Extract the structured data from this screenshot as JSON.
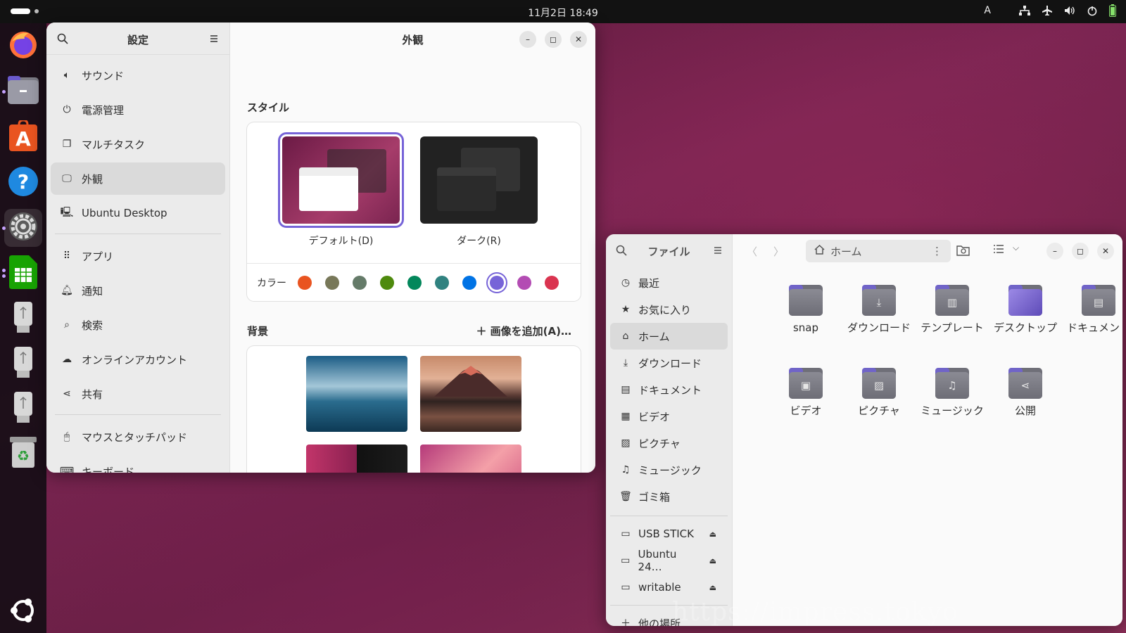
{
  "topbar": {
    "clock": "11月2日  18:49",
    "ime": "A"
  },
  "dock": {
    "apps": [
      "firefox-icon",
      "files-icon",
      "app-center-icon",
      "help-icon",
      "settings-icon",
      "spreadsheet-icon",
      "usb-drive-icon",
      "usb-drive-icon",
      "usb-drive-icon",
      "trash-icon"
    ],
    "bottom": "ubuntu-logo-icon"
  },
  "settings": {
    "sidebar_title": "設定",
    "page_title": "外観",
    "items": [
      {
        "label": "サウンド",
        "icon": "speaker-icon"
      },
      {
        "label": "電源管理",
        "icon": "power-icon"
      },
      {
        "label": "マルチタスク",
        "icon": "multitask-icon"
      },
      {
        "label": "外観",
        "icon": "appearance-icon",
        "selected": true
      },
      {
        "label": "Ubuntu Desktop",
        "icon": "desktop-icon"
      },
      {
        "label": "アプリ",
        "icon": "apps-grid-icon"
      },
      {
        "label": "通知",
        "icon": "bell-icon"
      },
      {
        "label": "検索",
        "icon": "search-icon"
      },
      {
        "label": "オンラインアカウント",
        "icon": "cloud-icon"
      },
      {
        "label": "共有",
        "icon": "share-icon"
      },
      {
        "label": "マウスとタッチパッド",
        "icon": "mouse-icon"
      },
      {
        "label": "キーボード",
        "icon": "keyboard-icon"
      }
    ],
    "style_section": "スタイル",
    "style_default": "デフォルト(D)",
    "style_dark": "ダーク(R)",
    "color_label": "カラー",
    "colors": [
      "#e95420",
      "#787859",
      "#657b69",
      "#4e8a0d",
      "#03875b",
      "#308280",
      "#0073e5",
      "#7764d8",
      "#b34cb3",
      "#da3450"
    ],
    "selected_color": "#7764d8",
    "background_section": "背景",
    "add_image": "画像を追加(A)…"
  },
  "files": {
    "sidebar_title": "ファイル",
    "path": "ホーム",
    "places": [
      {
        "label": "最近",
        "icon": "clock-icon"
      },
      {
        "label": "お気に入り",
        "icon": "star-icon"
      },
      {
        "label": "ホーム",
        "icon": "home-icon",
        "selected": true
      },
      {
        "label": "ダウンロード",
        "icon": "download-icon"
      },
      {
        "label": "ドキュメント",
        "icon": "document-icon"
      },
      {
        "label": "ビデオ",
        "icon": "video-icon"
      },
      {
        "label": "ピクチャ",
        "icon": "picture-icon"
      },
      {
        "label": "ミュージック",
        "icon": "music-icon"
      },
      {
        "label": "ゴミ箱",
        "icon": "trash-icon"
      }
    ],
    "drives": [
      {
        "label": "USB STICK"
      },
      {
        "label": "Ubuntu 24…"
      },
      {
        "label": "writable"
      }
    ],
    "other_places": "他の場所",
    "folders": [
      {
        "name": "snap",
        "glyph": ""
      },
      {
        "name": "ダウンロード",
        "glyph": "⤓"
      },
      {
        "name": "テンプレート",
        "glyph": "▥"
      },
      {
        "name": "デスクトップ",
        "glyph": ""
      },
      {
        "name": "ドキュメント",
        "glyph": "▤"
      },
      {
        "name": "ビデオ",
        "glyph": "▣"
      },
      {
        "name": "ピクチャ",
        "glyph": "▨"
      },
      {
        "name": "ミュージック",
        "glyph": "♫"
      },
      {
        "name": "公開",
        "glyph": "⋖"
      }
    ]
  },
  "watermark": "https://impress.tokyo"
}
